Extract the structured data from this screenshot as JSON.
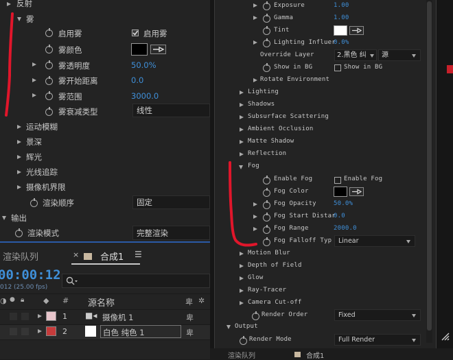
{
  "left_props": {
    "reflection": "反射",
    "fog": "雾",
    "enable_fog": "启用雾",
    "enable_fog_check": "启用雾",
    "fog_color": "雾颜色",
    "fog_opacity": "雾透明度",
    "fog_opacity_val": "50.0%",
    "fog_start": "雾开始距离",
    "fog_start_val": "0.0",
    "fog_range": "雾范围",
    "fog_range_val": "3000.0",
    "fog_falloff": "雾衰减类型",
    "fog_falloff_val": "线性",
    "motion_blur": "运动模糊",
    "dof": "景深",
    "glow": "辉光",
    "ray_tracer": "光线追踪",
    "camera_cutoff": "摄像机界限",
    "render_order": "渲染顺序",
    "render_order_val": "固定",
    "output": "输出",
    "render_mode": "渲染模式",
    "render_mode_val": "完整渲染"
  },
  "timeline": {
    "tab_render_queue": "渲染队列",
    "tab_comp": "合成1",
    "timecode": "00:00:12",
    "fps": "012 (25.00 fps)",
    "col_num": "#",
    "col_source": "源名称",
    "layers": [
      {
        "num": "1",
        "name": "摄像机 1",
        "color": "#e8c6cc"
      },
      {
        "num": "2",
        "name": "白色 纯色 1",
        "color": "#c63b3b"
      }
    ]
  },
  "right_props": {
    "exposure": "Exposure",
    "exposure_val": "1.00",
    "gamma": "Gamma",
    "gamma_val": "1.00",
    "tint": "Tint",
    "lighting_influence": "Lighting Influer",
    "lighting_influence_val": "0.0%",
    "override_layer": "Override Layer",
    "override_layer_val": "2.黑色 纠",
    "override_source_val": "源",
    "show_in_bg": "Show in BG",
    "show_in_bg_check": "Show in BG",
    "rotate_env": "Rotate Environment",
    "lighting": "Lighting",
    "shadows": "Shadows",
    "sss": "Subsurface Scattering",
    "ao": "Ambient Occlusion",
    "matte_shadow": "Matte Shadow",
    "reflection": "Reflection",
    "fog": "Fog",
    "enable_fog": "Enable Fog",
    "enable_fog_check": "Enable Fog",
    "fog_color": "Fog Color",
    "fog_opacity": "Fog Opacity",
    "fog_opacity_val": "50.0%",
    "fog_start": "Fog Start Distar",
    "fog_start_val": "0.0",
    "fog_range": "Fog Range",
    "fog_range_val": "2000.0",
    "fog_falloff": "Fog Falloff Typ",
    "fog_falloff_val": "Linear",
    "motion_blur": "Motion Blur",
    "dof": "Depth of Field",
    "glow": "Glow",
    "ray_tracer": "Ray-Tracer",
    "camera_cutoff": "Camera Cut-off",
    "render_order": "Render Order",
    "render_order_val": "Fixed",
    "output": "Output",
    "render_mode": "Render Mode",
    "render_mode_val": "Full Render"
  },
  "bottom_right": {
    "render_queue": "渲染队列",
    "comp": "合成1"
  },
  "colors": {
    "accent_blue": "#3f8fd8",
    "annotation_red": "#e0162b",
    "white_swatch": "#ffffff",
    "black_swatch": "#000000"
  }
}
